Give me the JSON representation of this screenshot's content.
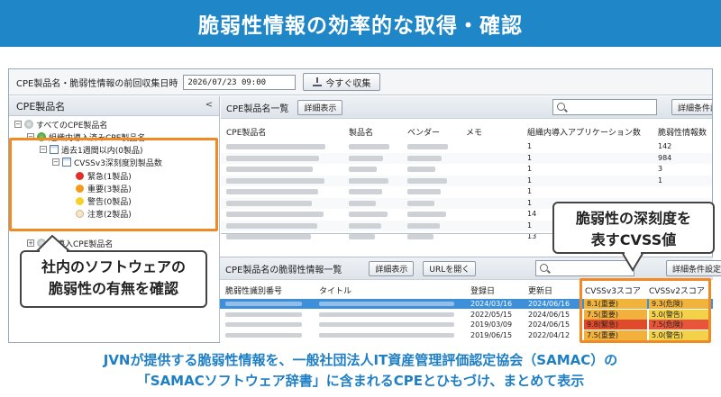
{
  "banner": {
    "title": "脆弱性情報の効率的な取得・確認"
  },
  "topbar": {
    "label": "CPE製品名・脆弱性情報の前回収集日時",
    "datetime": "2026/07/23 09:00",
    "collect_button": "今すぐ収集"
  },
  "left_pane": {
    "title": "CPE製品名",
    "collapse_glyph": "<",
    "tree": {
      "root": "すべてのCPE製品名",
      "in_house": "組織内導入済みCPE製品名",
      "last_week": "過去1週間以内(0製品)",
      "cvss": "CVSSv3深刻度別製品数",
      "urgent": "緊急(1製品)",
      "important": "重要(3製品)",
      "warning": "警告(0製品)",
      "caution": "注意(2製品)",
      "not_installed": "未導入CPE製品名"
    }
  },
  "cpe_list": {
    "title": "CPE製品名一覧",
    "detail_button": "詳細表示",
    "search_conditions_button": "詳細条件設定",
    "columns": [
      "CPE製品名",
      "製品名",
      "ベンダー",
      "メモ",
      "組織内導入アプリケーション数",
      "脆弱性情報数"
    ],
    "app_counts": [
      "1",
      "1",
      "1",
      "1",
      "1",
      "1",
      "14",
      "1",
      "13"
    ],
    "vuln_counts": [
      "142",
      "984",
      "3",
      "1",
      "",
      "",
      "",
      "",
      ""
    ]
  },
  "vuln_list": {
    "title": "CPE製品名の脆弱性情報一覧",
    "detail_button": "詳細表示",
    "url_button": "URLを開く",
    "search_conditions_button": "詳細条件設定",
    "columns": [
      "脆弱性識別番号",
      "タイトル",
      "登録日",
      "更新日",
      "CVSSv3スコア",
      "CVSSv2スコア"
    ],
    "rows": [
      {
        "registered": "2024/03/16",
        "updated": "2024/06/16",
        "v3": "8.1(重要)",
        "v2": "9.3(危険)",
        "v3_color": "#f0b43c",
        "v2_color": "#f0b43c",
        "selected": true
      },
      {
        "registered": "2022/05/15",
        "updated": "2024/06/15",
        "v3": "7.5(重要)",
        "v2": "5.0(警告)",
        "v3_color": "#f2b03c",
        "v2_color": "#f3d24a",
        "selected": false
      },
      {
        "registered": "2019/03/09",
        "updated": "2024/06/15",
        "v3": "9.8(緊急)",
        "v2": "7.5(危険)",
        "v3_color": "#e04a2c",
        "v2_color": "#e8553a",
        "selected": false
      },
      {
        "registered": "2019/06/15",
        "updated": "2022/04/12",
        "v3": "7.5(重要)",
        "v2": "5.0(警告)",
        "v3_color": "#f2b03c",
        "v2_color": "#f3d24a",
        "selected": false
      }
    ]
  },
  "callouts": {
    "left": [
      "社内のソフトウェアの",
      "脆弱性の有無を確認"
    ],
    "right": [
      "脆弱性の深刻度を",
      "表すCVSS値"
    ]
  },
  "caption": [
    "JVNが提供する脆弱性情報を、一般社団法人IT資産管理評価認定協会（SAMAC）の",
    "「SAMACソフトウェア辞書」に含まれるCPEとひもづけ、まとめて表示"
  ],
  "colors": {
    "banner": "#1f86c8",
    "highlight": "#f08a24",
    "selected_row": "#3c8fd8",
    "caption": "#1f7fc4"
  }
}
